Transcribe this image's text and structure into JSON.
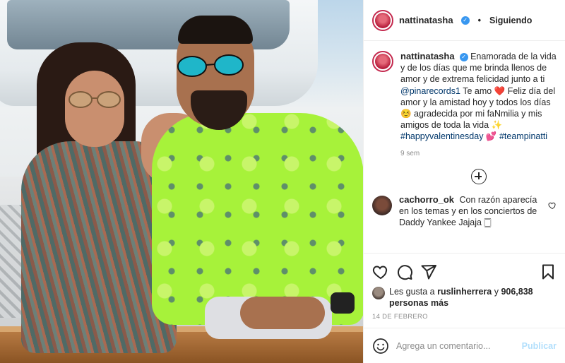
{
  "header": {
    "username": "nattinatasha",
    "separator": "•",
    "follow_status": "Siguiendo"
  },
  "caption": {
    "username": "nattinatasha",
    "text_1": "Enamorada de la vida y de los días que me brinda llenos de amor y de extrema felicidad junto a ti ",
    "mention": "@pinarecords1",
    "text_2": " Te amo ❤️ Feliz día del amor y la amistad hoy y todos los días ☺️ agradecida por mi faNmilia y mis amigos de toda la vida ✨ ",
    "hashtag_1": "#happyvalentinesday",
    "text_3": " 💕 ",
    "hashtag_2": "#teampinatti",
    "time": "9 sem"
  },
  "comment": {
    "username": "cachorro_ok",
    "text": "Con razón aparecía en los temas y en los conciertos de Daddy Yankee Jajaja 🀆"
  },
  "likes": {
    "prefix": "Les gusta a ",
    "user": "ruslinherrera",
    "connector": " y ",
    "count": "906,838 personas más"
  },
  "date": "14 DE FEBRERO",
  "add_comment": {
    "placeholder": "Agrega un comentario...",
    "publish_label": "Publicar"
  },
  "colors": {
    "link": "#00376b",
    "verified": "#3897f0",
    "publish_disabled": "#b2dffc"
  }
}
